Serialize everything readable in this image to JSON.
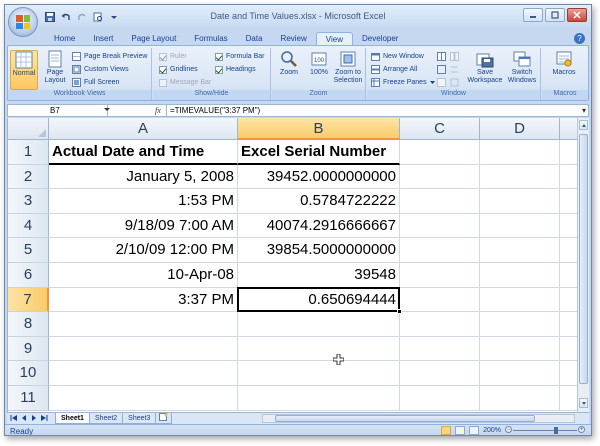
{
  "window": {
    "title": "Date and Time Values.xlsx - Microsoft Excel"
  },
  "ribbon": {
    "tabs": [
      {
        "label": "Home",
        "active": false
      },
      {
        "label": "Insert",
        "active": false
      },
      {
        "label": "Page Layout",
        "active": false
      },
      {
        "label": "Formulas",
        "active": false
      },
      {
        "label": "Data",
        "active": false
      },
      {
        "label": "Review",
        "active": false
      },
      {
        "label": "View",
        "active": true
      },
      {
        "label": "Developer",
        "active": false
      }
    ],
    "workbook_views": {
      "group_label": "Workbook Views",
      "normal": "Normal",
      "page_layout": "Page Layout",
      "page_break_preview": "Page Break Preview",
      "custom_views": "Custom Views",
      "full_screen": "Full Screen"
    },
    "show_hide": {
      "group_label": "Show/Hide",
      "ruler": "Ruler",
      "ruler_checked": true,
      "ruler_enabled": false,
      "gridlines": "Gridlines",
      "gridlines_checked": true,
      "message_bar": "Message Bar",
      "message_bar_checked": false,
      "message_bar_enabled": false,
      "formula_bar": "Formula Bar",
      "formula_bar_checked": true,
      "headings": "Headings",
      "headings_checked": true
    },
    "zoom": {
      "group_label": "Zoom",
      "zoom": "Zoom",
      "hundred": "100%",
      "zoom_to_selection": "Zoom to Selection"
    },
    "window_group": {
      "group_label": "Window",
      "new_window": "New Window",
      "arrange_all": "Arrange All",
      "freeze_panes": "Freeze Panes",
      "save_workspace": "Save Workspace",
      "switch_windows": "Switch Windows"
    },
    "macros": {
      "group_label": "Macros",
      "macros": "Macros"
    }
  },
  "formula_bar": {
    "name_box": "B7",
    "fx": "fx",
    "formula": "=TIMEVALUE(\"3:37 PM\")"
  },
  "sheet": {
    "columns": [
      "A",
      "B",
      "C",
      "D"
    ],
    "rows": [
      "1",
      "2",
      "3",
      "4",
      "5",
      "6",
      "7",
      "8",
      "9",
      "10",
      "11"
    ],
    "active_cell": "B7",
    "cells": [
      {
        "a": "Actual Date and Time",
        "b": "Excel Serial Number"
      },
      {
        "a": "January 5, 2008",
        "b": "39452.0000000000"
      },
      {
        "a": "1:53 PM",
        "b": "0.5784722222"
      },
      {
        "a": "9/18/09 7:00 AM",
        "b": "40074.2916666667"
      },
      {
        "a": "2/10/09 12:00 PM",
        "b": "39854.5000000000"
      },
      {
        "a": "10-Apr-08",
        "b": "39548"
      },
      {
        "a": "3:37 PM",
        "b": "0.650694444"
      }
    ],
    "sheet_tabs": [
      {
        "label": "Sheet1",
        "active": true
      },
      {
        "label": "Sheet2",
        "active": false
      },
      {
        "label": "Sheet3",
        "active": false
      }
    ]
  },
  "status_bar": {
    "mode": "Ready",
    "zoom": "200%",
    "zoom_level_pct": 200
  },
  "colors": {
    "accent": "#f9cc6a",
    "ribbon_bg": "#dae6f5",
    "header_text": "#27415f"
  }
}
